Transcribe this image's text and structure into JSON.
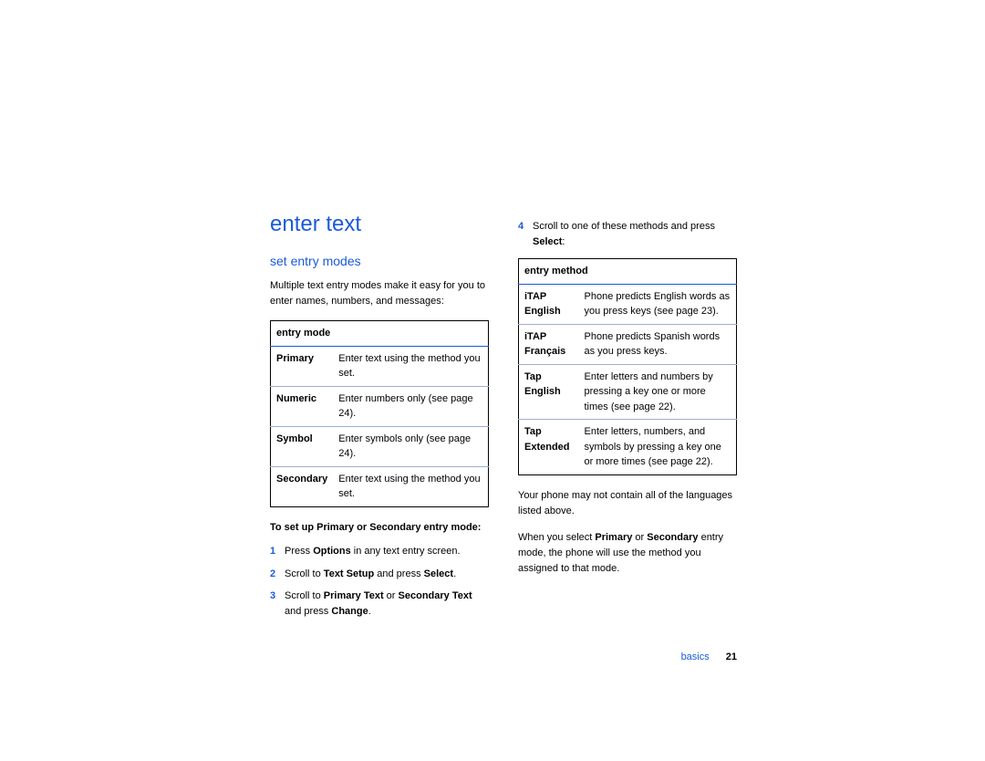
{
  "left": {
    "h1": "enter text",
    "h2": "set entry modes",
    "intro": "Multiple text entry modes make it easy for you to enter names, numbers, and messages:",
    "table_header": "entry mode",
    "rows": [
      {
        "mode": "Primary",
        "desc": "Enter text using the method you set."
      },
      {
        "mode": "Numeric",
        "desc": "Enter numbers only (see page 24)."
      },
      {
        "mode": "Symbol",
        "desc": "Enter symbols only (see page 24)."
      },
      {
        "mode": "Secondary",
        "desc": "Enter text using the method you set."
      }
    ],
    "subhead": "To set up Primary or Secondary entry mode:",
    "steps": {
      "s1_a": "Press ",
      "s1_b": "Options",
      "s1_c": " in any text entry screen.",
      "s2_a": "Scroll to ",
      "s2_b": "Text Setup",
      "s2_c": " and press ",
      "s2_d": "Select",
      "s2_e": ".",
      "s3_a": "Scroll to ",
      "s3_b": "Primary Text",
      "s3_c": " or ",
      "s3_d": "Secondary Text",
      "s3_e": " and press ",
      "s3_f": "Change",
      "s3_g": "."
    }
  },
  "right": {
    "step4_a": "Scroll to one of these methods and press ",
    "step4_b": "Select",
    "step4_c": ":",
    "table_header": "entry method",
    "rows": [
      {
        "mode": "iTAP English",
        "desc": "Phone predicts English words as you press keys (see page 23)."
      },
      {
        "mode": "iTAP Français",
        "desc": "Phone predicts Spanish words as you press keys."
      },
      {
        "mode": "Tap English",
        "desc": "Enter letters and numbers by pressing a key one or more times (see page 22)."
      },
      {
        "mode": "Tap Extended",
        "desc": "Enter letters, numbers, and symbols by pressing a key one or more times (see page 22)."
      }
    ],
    "note1": "Your phone may not contain all of the languages listed above.",
    "note2_a": "When you select ",
    "note2_b": "Primary",
    "note2_c": " or ",
    "note2_d": "Secondary",
    "note2_e": " entry mode, the phone will use the method you assigned to that mode."
  },
  "footer": {
    "section": "basics",
    "page": "21"
  }
}
